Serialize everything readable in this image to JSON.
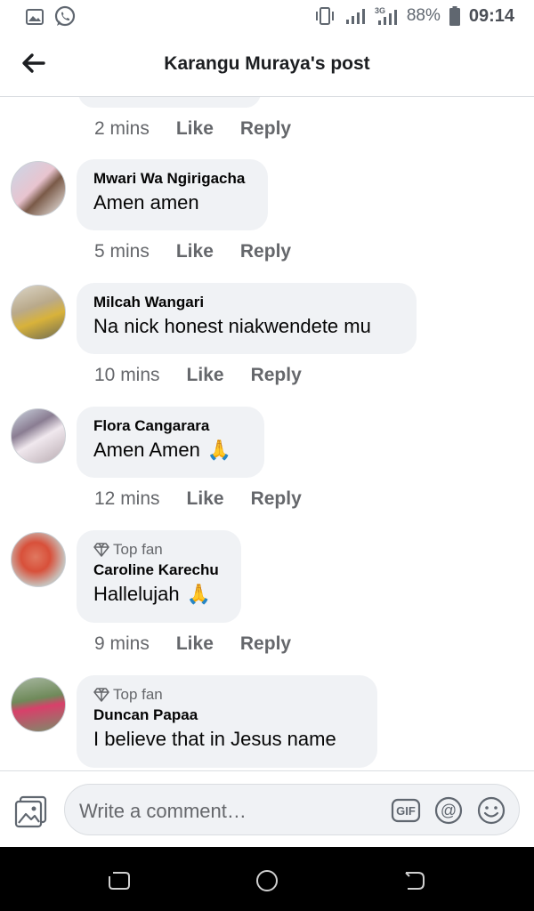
{
  "status_bar": {
    "battery": "88%",
    "time": "09:14",
    "network": "3G",
    "icons": [
      "gallery-icon",
      "whatsapp-icon",
      "vibrate-icon",
      "signal-icon",
      "signal-3g-icon",
      "battery-icon"
    ]
  },
  "header": {
    "title": "Karangu Muraya's post",
    "back_icon": "arrow-left-icon"
  },
  "first_meta": {
    "time": "2 mins",
    "like": "Like",
    "reply": "Reply"
  },
  "comments": [
    {
      "author": "Mwari Wa Ngirigacha",
      "text": "Amen amen",
      "emoji": "",
      "top_fan": false,
      "time": "5 mins",
      "like": "Like",
      "reply": "Reply"
    },
    {
      "author": "Milcah Wangari",
      "text": "Na nick honest niakwendete mu",
      "emoji": "",
      "top_fan": false,
      "time": "10 mins",
      "like": "Like",
      "reply": "Reply"
    },
    {
      "author": "Flora Cangarara",
      "text": "Amen Amen",
      "emoji": "🙏",
      "top_fan": false,
      "time": "12 mins",
      "like": "Like",
      "reply": "Reply"
    },
    {
      "author": "Caroline Karechu",
      "text": "Hallelujah",
      "emoji": "🙏",
      "top_fan": true,
      "badge": "Top fan",
      "time": "9 mins",
      "like": "Like",
      "reply": "Reply"
    },
    {
      "author": "Duncan Papaa",
      "text": "I believe that in Jesus name",
      "emoji": "",
      "top_fan": true,
      "badge": "Top fan"
    }
  ],
  "composer": {
    "placeholder": "Write a comment…",
    "gif_label": "GIF",
    "at_label": "@"
  },
  "colors": {
    "bubble": "#f0f2f5",
    "meta": "#65676b",
    "navbar": "#000000"
  }
}
